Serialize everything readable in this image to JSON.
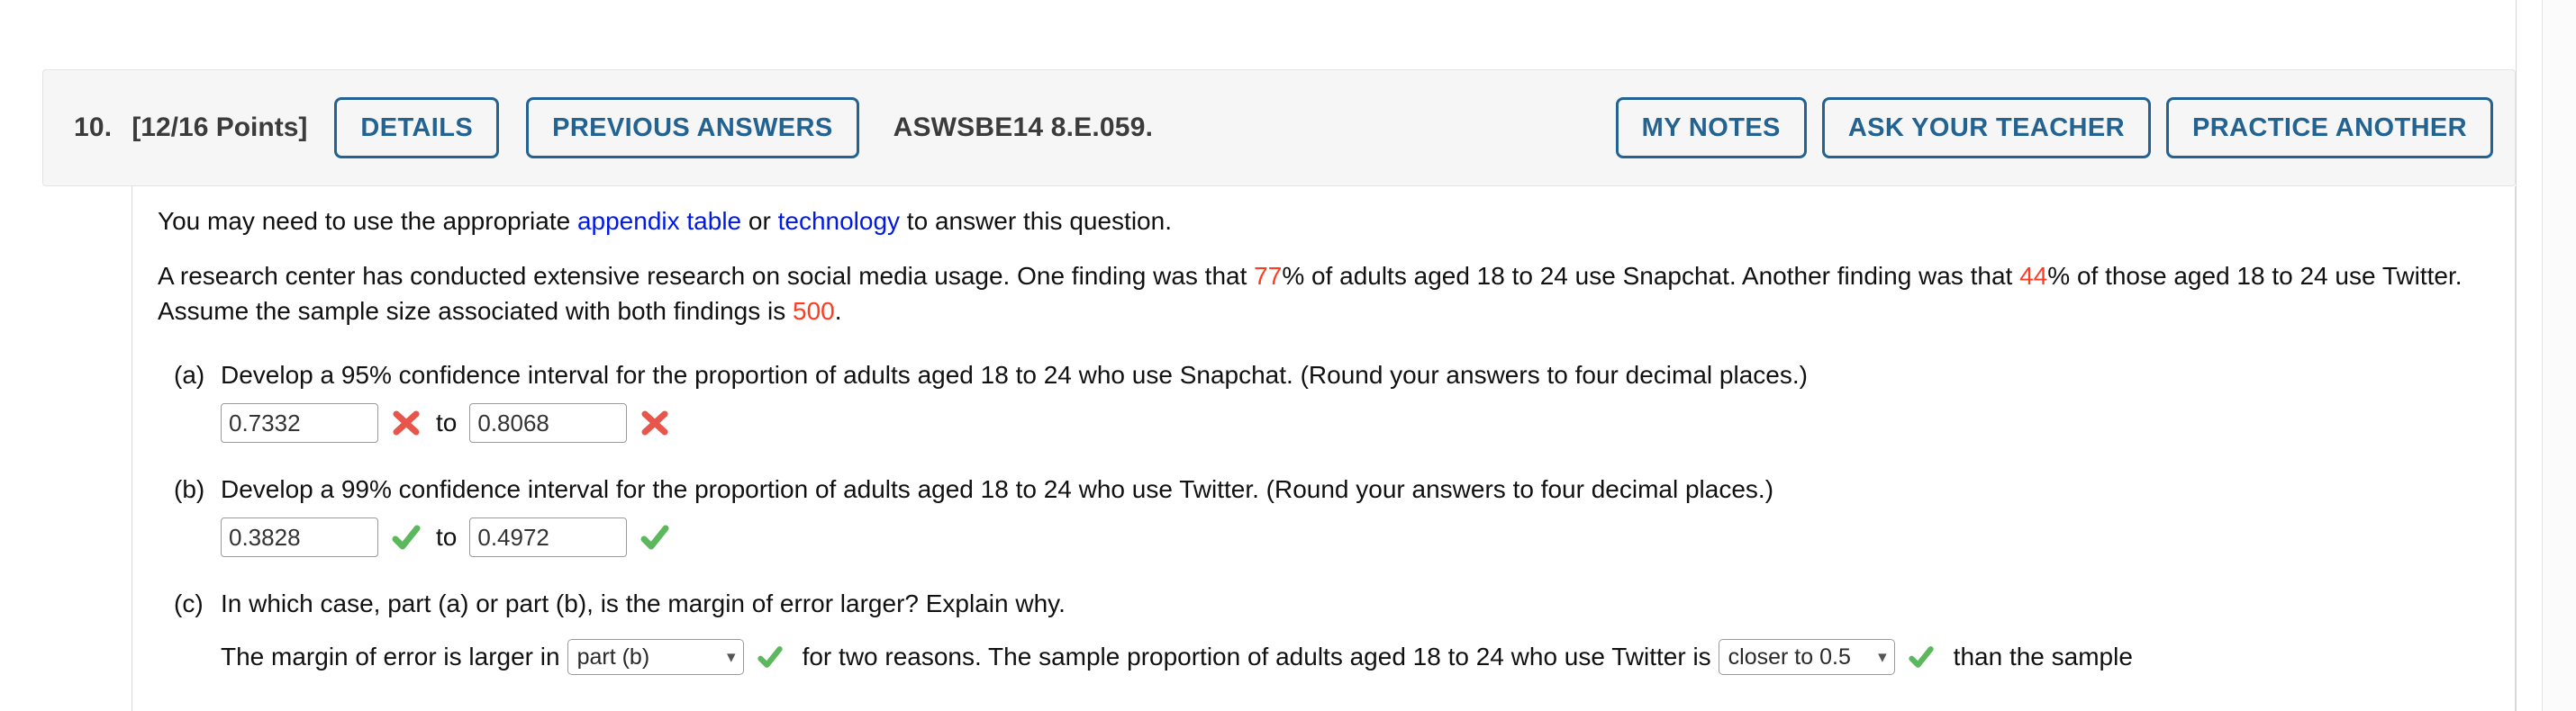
{
  "header": {
    "question_number": "10.",
    "points": "[12/16 Points]",
    "details_label": "DETAILS",
    "previous_answers_label": "PREVIOUS ANSWERS",
    "question_code": "ASWSBE14 8.E.059.",
    "my_notes_label": "MY NOTES",
    "ask_your_teacher_label": "ASK YOUR TEACHER",
    "practice_another_label": "PRACTICE ANOTHER",
    "accent_color": "#226392",
    "background_color": "#f6f6f6"
  },
  "intro": {
    "text_before_link1": "You may need to use the appropriate ",
    "link1": "appendix table",
    "text_between_links": " or ",
    "link2": "technology",
    "text_after_link2": " to answer this question.",
    "link_color": "#0019e6"
  },
  "problem": {
    "seg1": "A research center has conducted extensive research on social media usage. One finding was that ",
    "value_snapchat": "77",
    "seg2": "% of adults aged 18 to 24 use Snapchat. Another finding was that ",
    "value_twitter": "44",
    "seg3": "% of those aged 18 to 24 use Twitter. Assume the sample size associated with both findings is ",
    "value_sample_size": "500",
    "seg4": ".",
    "highlight_color": "#ff3b20"
  },
  "parts": [
    {
      "label": "(a)",
      "prompt": "Develop a 95% confidence interval for the proportion of adults aged 18 to 24 who use Snapchat. (Round your answers to four decimal places.)",
      "lower_value": "0.7332",
      "upper_value": "0.8068",
      "lower_status": "incorrect",
      "upper_status": "incorrect",
      "to_label": "to"
    },
    {
      "label": "(b)",
      "prompt": "Develop a 99% confidence interval for the proportion of adults aged 18 to 24 who use Twitter. (Round your answers to four decimal places.)",
      "lower_value": "0.3828",
      "upper_value": "0.4972",
      "lower_status": "correct",
      "upper_status": "correct",
      "to_label": "to"
    }
  ],
  "part_c": {
    "label": "(c)",
    "prompt": "In which case, part (a) or part (b), is the margin of error larger? Explain why.",
    "tail_seg1": "The margin of error is larger in",
    "select1_value": "part (b)",
    "tail_seg2": "for two reasons. The sample proportion of adults aged 18 to 24 who use Twitter is",
    "select2_value": "closer to 0.5",
    "tail_seg3": "than the sample",
    "select1_status": "correct",
    "select2_status": "correct"
  },
  "status_colors": {
    "correct": "#5cb85c",
    "incorrect": "#e8564b"
  }
}
